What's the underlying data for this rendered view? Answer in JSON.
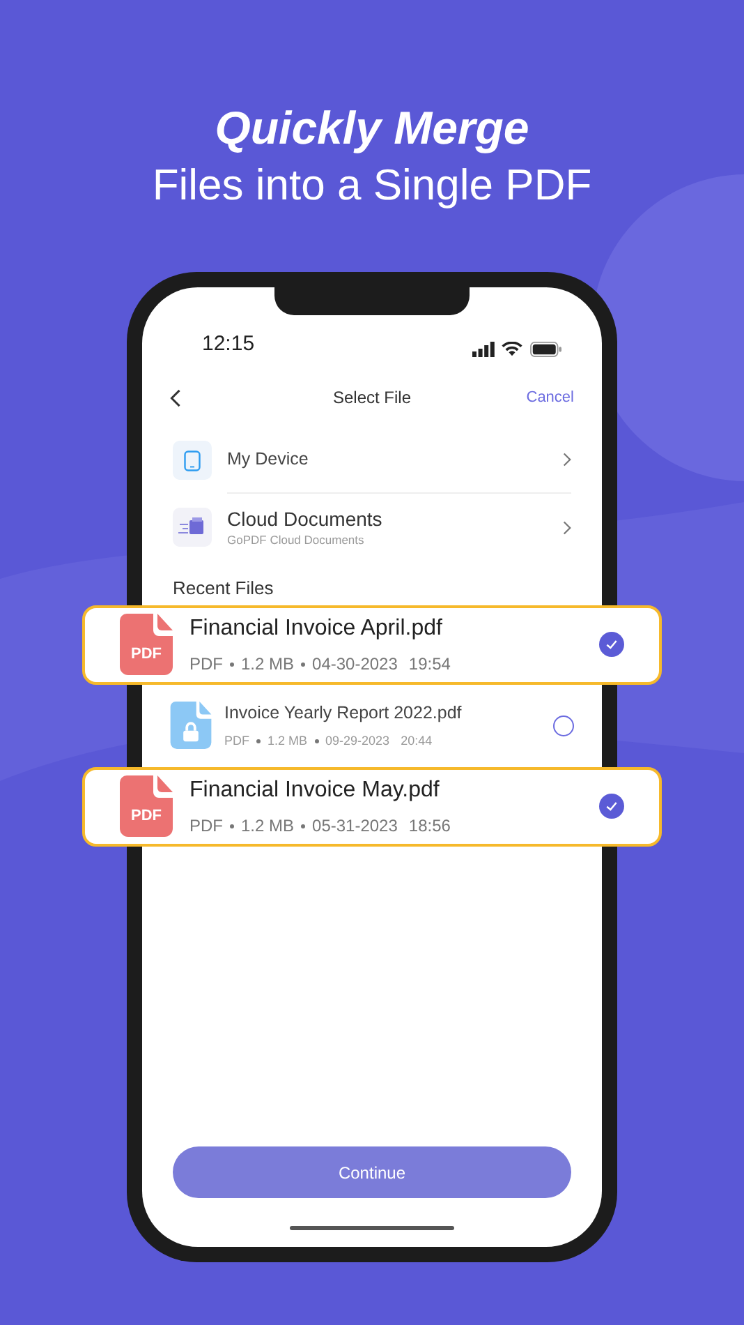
{
  "headline": {
    "emphasis": "Quickly Merge",
    "line": "Files into a Single PDF"
  },
  "status_bar": {
    "time": "12:15"
  },
  "nav": {
    "title": "Select File",
    "cancel": "Cancel"
  },
  "sources": [
    {
      "kind": "device",
      "title": "My Device"
    },
    {
      "kind": "cloud",
      "title": "Cloud Documents",
      "subtitle": "GoPDF Cloud Documents"
    }
  ],
  "recent": {
    "heading": "Recent Files",
    "files": [
      {
        "kind": "pdf",
        "icon_label": "PDF",
        "name": "Financial Invoice April.pdf",
        "type": "PDF",
        "size": "1.2 MB",
        "date": "04-30-2023",
        "time": "19:54",
        "selected": true
      },
      {
        "kind": "locked",
        "name": "Invoice Yearly Report 2022.pdf",
        "type": "PDF",
        "size": "1.2 MB",
        "date": "09-29-2023",
        "time": "20:44",
        "selected": false
      },
      {
        "kind": "pdf",
        "icon_label": "PDF",
        "name": "Financial Invoice May.pdf",
        "type": "PDF",
        "size": "1.2 MB",
        "date": "05-31-2023",
        "time": "18:56",
        "selected": true
      }
    ]
  },
  "continue_button": "Continue"
}
